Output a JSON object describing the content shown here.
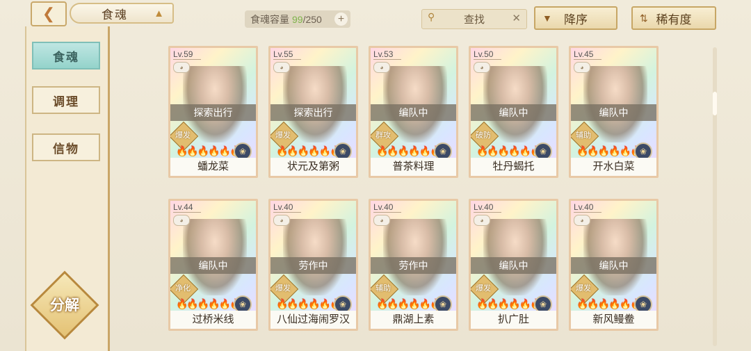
{
  "header": {
    "back_icon": "back-arrow-icon",
    "title": "食魂",
    "capacity_label": "食魂容量",
    "capacity_current": "99",
    "capacity_max": "/250",
    "search_label": "查找",
    "sort_desc_label": "降序",
    "sort_rarity_label": "稀有度"
  },
  "sidebar": {
    "tabs": [
      {
        "label": "食魂",
        "active": true
      },
      {
        "label": "调理",
        "active": false
      },
      {
        "label": "信物",
        "active": false
      }
    ],
    "decompose_label": "分解"
  },
  "cards": [
    {
      "level": "Lv.59",
      "status": "探索出行",
      "role": "爆发",
      "stars": 4,
      "name": "蟠龙菜"
    },
    {
      "level": "Lv.55",
      "status": "探索出行",
      "role": "爆发",
      "stars": 4,
      "name": "状元及第粥"
    },
    {
      "level": "Lv.53",
      "status": "编队中",
      "role": "群攻",
      "stars": 4,
      "name": "普茶料理"
    },
    {
      "level": "Lv.50",
      "status": "编队中",
      "role": "破防",
      "stars": 4,
      "name": "牡丹蝎托"
    },
    {
      "level": "Lv.45",
      "status": "编队中",
      "role": "辅助",
      "stars": 4,
      "name": "开水白菜"
    },
    {
      "level": "Lv.44",
      "status": "编队中",
      "role": "净化",
      "stars": 4,
      "name": "过桥米线"
    },
    {
      "level": "Lv.40",
      "status": "劳作中",
      "role": "爆发",
      "stars": 4,
      "name": "八仙过海闹罗汉"
    },
    {
      "level": "Lv.40",
      "status": "劳作中",
      "role": "辅助",
      "stars": 4,
      "name": "鼎湖上素"
    },
    {
      "level": "Lv.40",
      "status": "编队中",
      "role": "爆发",
      "stars": 4,
      "name": "扒广肚"
    },
    {
      "level": "Lv.40",
      "status": "编队中",
      "role": "爆发",
      "stars": 4,
      "name": "新风鳗鲞"
    }
  ]
}
